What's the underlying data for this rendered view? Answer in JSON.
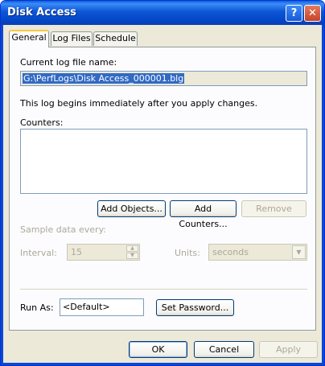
{
  "window": {
    "title": "Disk Access",
    "help_glyph": "?",
    "close_glyph": "✕"
  },
  "tabs": [
    {
      "label": "General",
      "active": true
    },
    {
      "label": "Log Files",
      "active": false
    },
    {
      "label": "Schedule",
      "active": false
    }
  ],
  "general": {
    "current_log_label": "Current log file name:",
    "current_log_value": "G:\\PerfLogs\\Disk Access_000001.blg",
    "info_text": "This log begins immediately after you apply changes.",
    "counters_label": "Counters:",
    "counters": [],
    "add_objects_label": "Add Objects...",
    "add_counters_label": "Add Counters...",
    "remove_label": "Remove",
    "sample_label": "Sample data every:",
    "interval_label": "Interval:",
    "interval_value": "15",
    "units_label": "Units:",
    "units_value": "seconds",
    "run_as_label": "Run As:",
    "run_as_value": "<Default>",
    "set_password_label": "Set Password..."
  },
  "footer": {
    "ok_label": "OK",
    "cancel_label": "Cancel",
    "apply_label": "Apply"
  },
  "colors": {
    "titlebar": "#0a5fd8",
    "dialog_bg": "#ece9d8",
    "selection": "#316ac5",
    "disabled_text": "#aca899"
  }
}
